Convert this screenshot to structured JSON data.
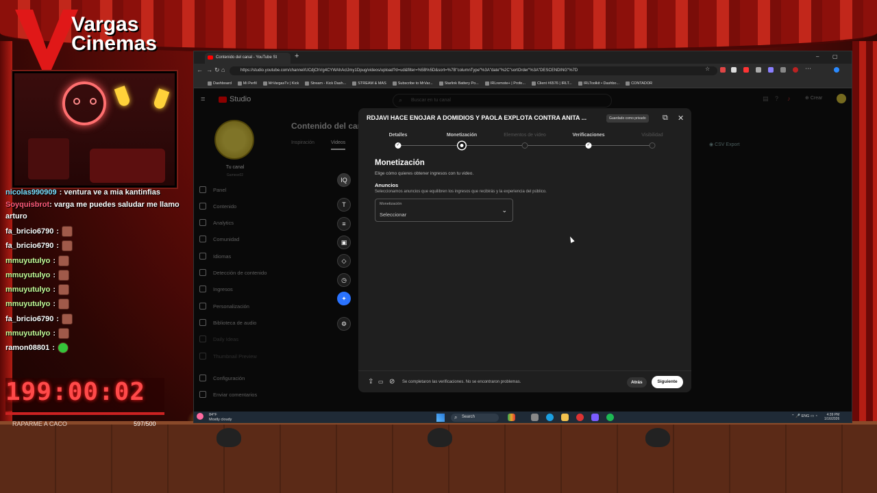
{
  "stream": {
    "logo_line1": "Vargas",
    "logo_line2": "Cinemas",
    "timer": "199:00:02",
    "goal_label": "RAPARME A CACO",
    "goal_count": "597/500",
    "chat": [
      {
        "user": "nicolas990909",
        "msg": ": ventura ve a mia kantinfias",
        "emote": false
      },
      {
        "user": "Soyquisbrot",
        "msg": ": varga me puedes saludar me llamo arturo",
        "emote": false
      },
      {
        "user": "fa_bricio6790",
        "msg": ":",
        "emote": true
      },
      {
        "user": "fa_bricio6790",
        "msg": ":",
        "emote": true
      },
      {
        "user": "mmuyutulyo",
        "msg": ":",
        "emote": true
      },
      {
        "user": "mmuyutulyo",
        "msg": ":",
        "emote": true
      },
      {
        "user": "mmuyutulyo",
        "msg": ":",
        "emote": true
      },
      {
        "user": "mmuyutulyo",
        "msg": ":",
        "emote": true
      },
      {
        "user": "fa_bricio6790",
        "msg": ":",
        "emote": true
      },
      {
        "user": "mmuyutulyo",
        "msg": ":",
        "emote": true
      },
      {
        "user": "ramon08801",
        "msg": ":",
        "emote": true
      }
    ]
  },
  "browser": {
    "tab_title": "Contenido del canal - YouTube St",
    "url": "https://studio.youtube.com/channel/UCdjChVg4CYWAhAclJmy1Dpug/videos/upload?d=ud&filter=%5B%5D&sort=%7B\"columnType\"%3A\"date\"%2C\"sortOrder\"%3A\"DESCENDING\"%7D",
    "bookmarks": [
      "Dashboard",
      "Mi Perfil",
      "MrVargasTv | Kick",
      "Stream - Kick Dash...",
      "STREAM & MAS",
      "Subscribe to MrVar...",
      "Starlink Battery Po...",
      "IRLremote+ | Profe...",
      "Client #6576 | IRLT...",
      "IRLToolkit • Dashbo...",
      "CONTADOR"
    ]
  },
  "studio": {
    "logo": "Studio",
    "search_placeholder": "Buscar en tu canal",
    "channel_label": "Tu canal",
    "channel_handle": "Gamesx02",
    "create_label": "Crear",
    "page_title": "Contenido del canal",
    "tab_inspiracion": "Inspiración",
    "tab_videos": "Videos",
    "csv_export": "CSV Export",
    "sidebar": [
      {
        "label": "Panel",
        "dim": false
      },
      {
        "label": "Contenido",
        "dim": false
      },
      {
        "label": "Analytics",
        "dim": false
      },
      {
        "label": "Comunidad",
        "dim": false
      },
      {
        "label": "Idiomas",
        "dim": false
      },
      {
        "label": "Detección de contenido",
        "dim": false
      },
      {
        "label": "Ingresos",
        "dim": false
      },
      {
        "label": "Personalización",
        "dim": false
      },
      {
        "label": "Biblioteca de audio",
        "dim": false
      },
      {
        "label": "Daily Ideas",
        "dim": true
      },
      {
        "label": "Thumbnail Preview",
        "dim": true
      },
      {
        "label": "Configuración",
        "dim": false
      },
      {
        "label": "Enviar comentarios",
        "dim": false
      }
    ]
  },
  "dialog": {
    "title": "RDJAVI HACE ENOJAR A DOMIDIOS Y PAOLA EXPLOTA CONTRA ANITA ...",
    "badge": "Guardado como privado",
    "steps": [
      {
        "label": "Detalles",
        "state": "done"
      },
      {
        "label": "Monetización",
        "state": "current"
      },
      {
        "label": "Elementos de video",
        "state": "todo"
      },
      {
        "label": "Verificaciones",
        "state": "done"
      },
      {
        "label": "Visibilidad",
        "state": "todo"
      }
    ],
    "heading": "Monetización",
    "subheading": "Elige cómo quieres obtener ingresos con tu video.",
    "section_title": "Anuncios",
    "section_desc": "Seleccionamos anuncios que equilibren los ingresos que recibirás y la experiencia del público.",
    "select_label": "Monetización",
    "select_value": "Seleccionar",
    "footer_text": "Se completaron las verificaciones. No se encontraron problemas.",
    "back_label": "Atrás",
    "next_label": "Siguiente"
  },
  "taskbar": {
    "temp": "84°F",
    "weather": "Mostly cloudy",
    "search": "Search",
    "lang": "ENG",
    "time": "4:39 PM",
    "date": "1/16/2026"
  }
}
